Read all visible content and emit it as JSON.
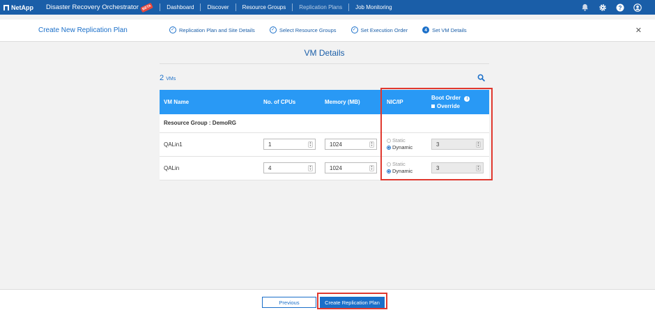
{
  "header": {
    "logo": "NetApp",
    "app_title": "Disaster Recovery Orchestrator",
    "badge": "BETA",
    "nav": [
      {
        "label": "Dashboard"
      },
      {
        "label": "Discover"
      },
      {
        "label": "Resource Groups"
      },
      {
        "label": "Replication Plans"
      },
      {
        "label": "Job Monitoring"
      }
    ],
    "icons": [
      "bell-icon",
      "gear-icon",
      "help-icon",
      "user-icon"
    ]
  },
  "wizard": {
    "title": "Create New Replication Plan",
    "steps": [
      {
        "label": "Replication Plan and Site Details",
        "state": "done"
      },
      {
        "label": "Select Resource Groups",
        "state": "done"
      },
      {
        "label": "Set Execution Order",
        "state": "done"
      },
      {
        "label": "Set VM Details",
        "state": "current",
        "number": "4"
      }
    ]
  },
  "section": {
    "title": "VM Details",
    "count": "2",
    "count_unit": "VMs"
  },
  "table": {
    "headers": {
      "name": "VM Name",
      "cpu": "No. of CPUs",
      "memory": "Memory (MB)",
      "nic": "NIC/IP",
      "boot": "Boot Order",
      "override": "Override"
    },
    "group_label": "Resource Group : DemoRG",
    "rows": [
      {
        "name": "QALin1",
        "cpu": "1",
        "memory": "1024",
        "static": "Static",
        "dynamic": "Dynamic",
        "boot": "3"
      },
      {
        "name": "QALin",
        "cpu": "4",
        "memory": "1024",
        "static": "Static",
        "dynamic": "Dynamic",
        "boot": "3"
      }
    ]
  },
  "footer": {
    "previous": "Previous",
    "create": "Create Replication Plan"
  },
  "colors": {
    "brand": "#1a5ea8",
    "accent": "#2999f5",
    "highlight": "#e0382e"
  }
}
